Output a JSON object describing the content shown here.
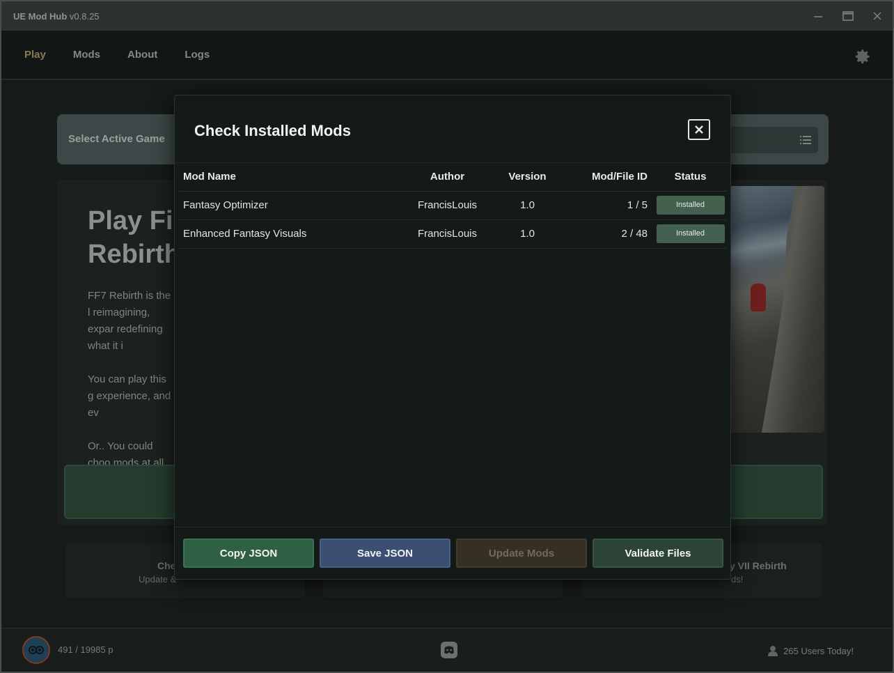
{
  "window": {
    "app_name": "UE Mod Hub",
    "version": "v0.8.25",
    "controls": {
      "minimize_icon": "minimize-icon",
      "maximize_icon": "maximize-icon",
      "close_icon": "close-icon"
    }
  },
  "nav": {
    "items": [
      {
        "label": "Play",
        "active": true
      },
      {
        "label": "Mods",
        "active": false
      },
      {
        "label": "About",
        "active": false
      },
      {
        "label": "Logs",
        "active": false
      }
    ],
    "settings_icon": "gear-icon"
  },
  "background": {
    "game_select_label": "Select Active Game",
    "heading_line1": "Play Fi",
    "heading_line2": "Rebirth",
    "desc": [
      "FF7 Rebirth is the l reimagining, expar redefining what it i",
      "You can play this g experience, and ev",
      "Or.. You could choo mods at all, but tha"
    ],
    "cards": [
      {
        "title": "Che",
        "sub": "Update &"
      },
      {
        "title": "",
        "sub": ""
      },
      {
        "title": "y VII Rebirth",
        "sub": "ds!"
      }
    ]
  },
  "modal": {
    "title": "Check Installed Mods",
    "columns": [
      "Mod Name",
      "Author",
      "Version",
      "Mod/File ID",
      "Status"
    ],
    "rows": [
      {
        "name": "Fantasy Optimizer",
        "author": "FrancisLouis",
        "version": "1.0",
        "id": "1 / 5",
        "status": "Installed"
      },
      {
        "name": "Enhanced Fantasy Visuals",
        "author": "FrancisLouis",
        "version": "1.0",
        "id": "2 / 48",
        "status": "Installed"
      }
    ],
    "buttons": {
      "copy": "Copy JSON",
      "save": "Save JSON",
      "update": "Update Mods",
      "validate": "Validate Files"
    }
  },
  "footer": {
    "points": "491 / 19985 p",
    "users_today": "265 Users Today!"
  },
  "colors": {
    "accent_green": "#2f6044",
    "accent_blue": "#3c4e72",
    "status_installed": "#44614f",
    "nav_active": "#8a7a55"
  }
}
